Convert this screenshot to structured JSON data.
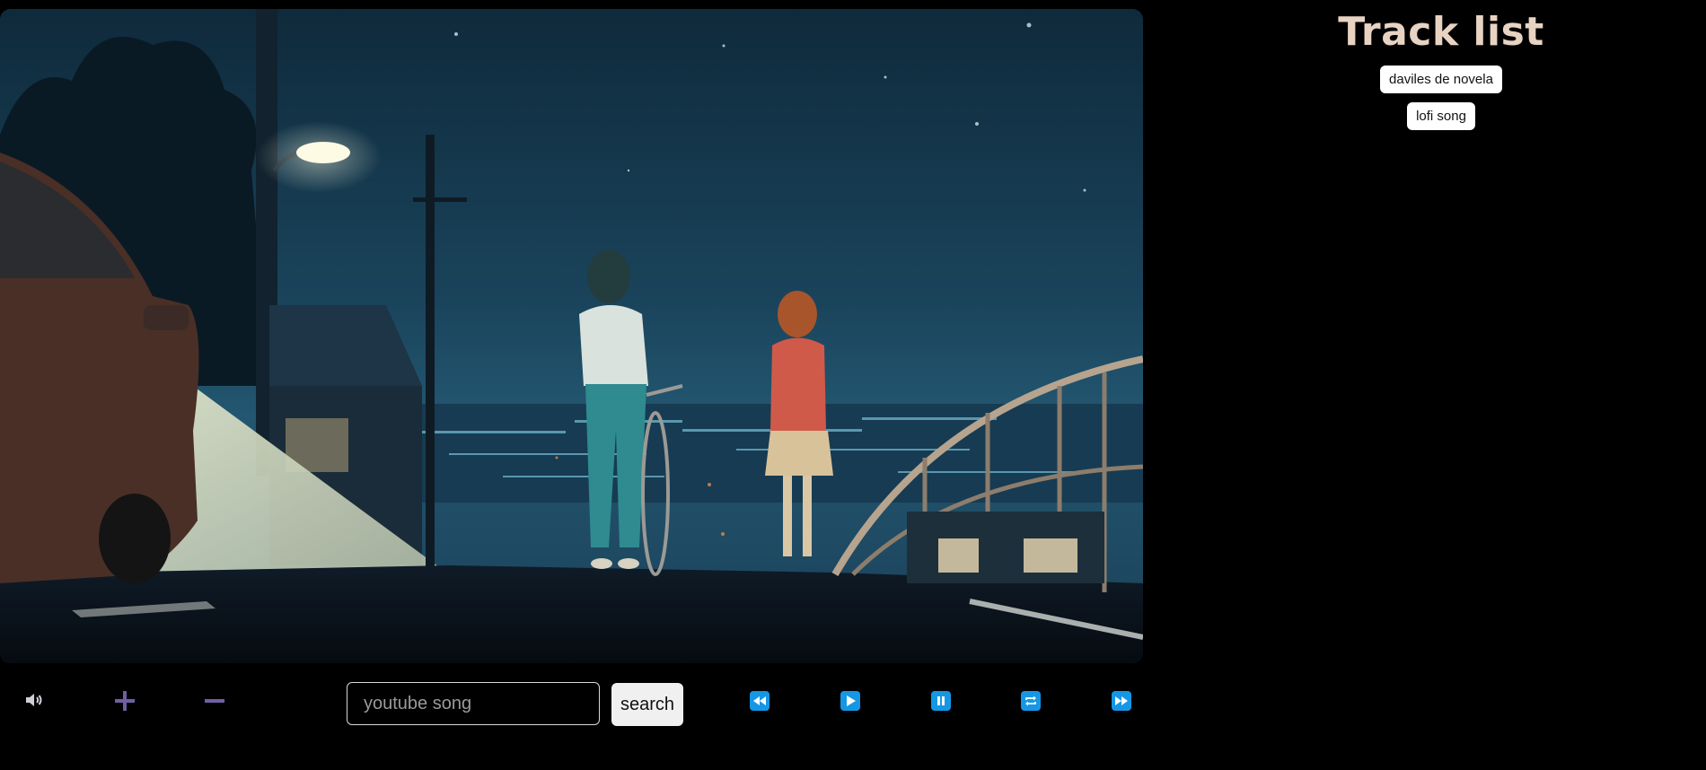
{
  "tracklist": {
    "title": "Track list",
    "items": [
      {
        "label": "daviles de novela"
      },
      {
        "label": "lofi song"
      }
    ]
  },
  "search": {
    "placeholder": "youtube song",
    "value": "",
    "button_label": "search"
  },
  "controls": {
    "volume_icon": "speaker-icon",
    "volume_up_icon": "plus-icon",
    "volume_down_icon": "minus-icon",
    "prev_icon": "rewind-icon",
    "play_icon": "play-icon",
    "pause_icon": "pause-icon",
    "loop_icon": "repeat-icon",
    "next_icon": "fast-forward-icon"
  },
  "colors": {
    "background": "#000000",
    "title": "#e8d3c2",
    "media_button": "#1597e5",
    "volume_accent": "#6f5fa3"
  }
}
